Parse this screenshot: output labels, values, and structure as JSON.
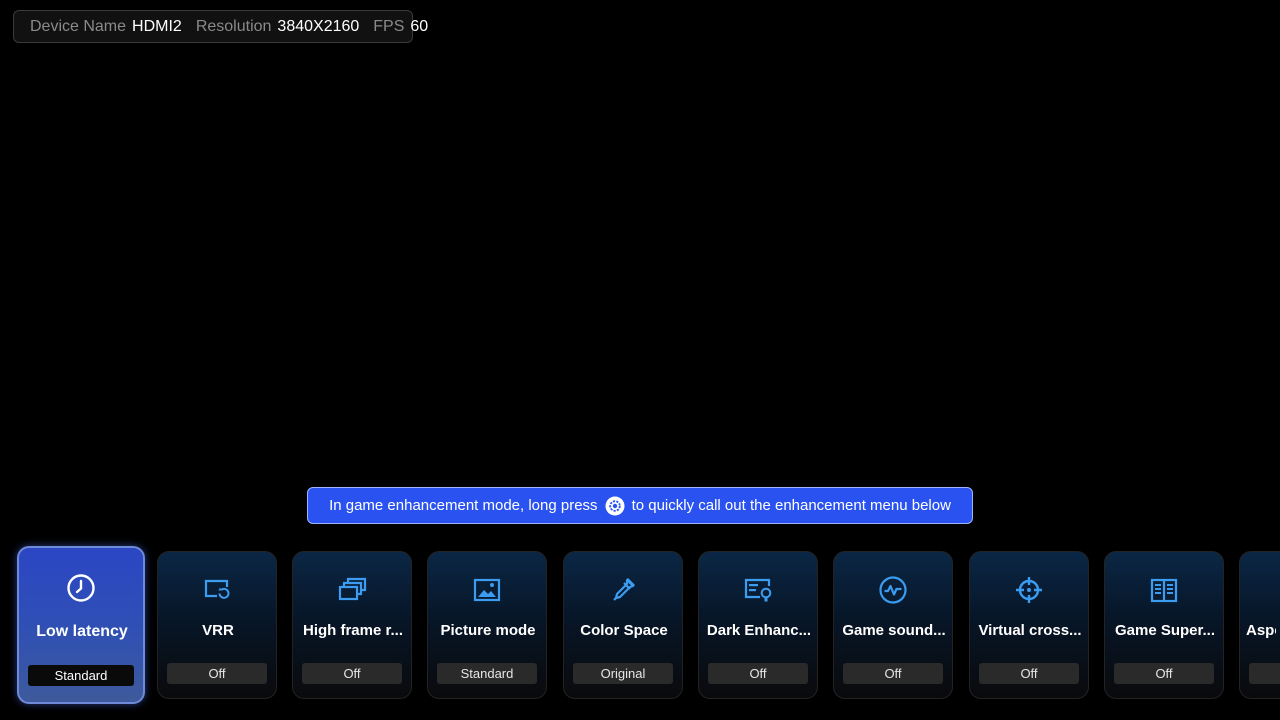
{
  "info": {
    "device_name_label": "Device Name",
    "device_name_value": "HDMI2",
    "resolution_label": "Resolution",
    "resolution_value": "3840X2160",
    "fps_label": "FPS",
    "fps_value": "60"
  },
  "toast": {
    "text_before": "In game enhancement mode, long press",
    "text_after": "to quickly call out the enhancement menu below",
    "icon": "gear-button-icon"
  },
  "cards": [
    {
      "title": "Low latency",
      "value": "Standard",
      "icon": "clock-icon"
    },
    {
      "title": "VRR",
      "value": "Off",
      "icon": "refresh-screen-icon"
    },
    {
      "title": "High frame r...",
      "value": "Off",
      "icon": "stacked-frames-icon"
    },
    {
      "title": "Picture mode",
      "value": "Standard",
      "icon": "picture-icon"
    },
    {
      "title": "Color Space",
      "value": "Original",
      "icon": "eyedropper-icon"
    },
    {
      "title": "Dark Enhanc...",
      "value": "Off",
      "icon": "screen-bulb-icon"
    },
    {
      "title": "Game sound...",
      "value": "Off",
      "icon": "waveform-icon"
    },
    {
      "title": "Virtual cross...",
      "value": "Off",
      "icon": "crosshair-icon"
    },
    {
      "title": "Game Super...",
      "value": "Off",
      "icon": "book-grid-icon"
    },
    {
      "title": "Aspe",
      "value": "",
      "icon": ""
    }
  ],
  "colors": {
    "accent": "#2a52f0",
    "icon": "#3b9cf0"
  }
}
